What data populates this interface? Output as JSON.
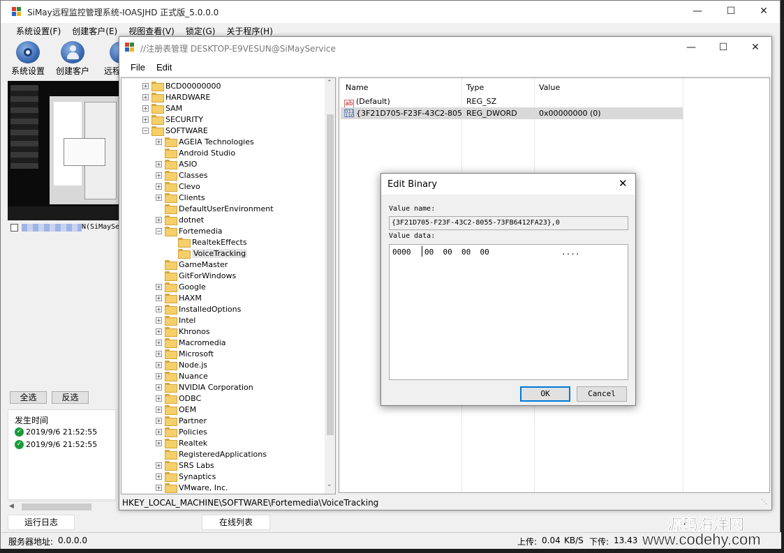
{
  "main_window": {
    "title": "SiMay远程监控管理系统-IOASJHD 正式版_5.0.0.0",
    "menu": [
      "系统设置(F)",
      "创建客户(E)",
      "视图查看(V)",
      "锁定(G)",
      "关于程序(H)"
    ],
    "toolbar": [
      "系统设置",
      "创建客户",
      "远程"
    ],
    "client_label": "N(SiMaySe",
    "select_all": "全选",
    "invert_select": "反选",
    "log_header": "发生时间",
    "log_entries": [
      "2019/9/6 21:52:55",
      "2019/9/6 21:52:55"
    ],
    "tabs": [
      "运行日志",
      "在线列表"
    ],
    "status": {
      "server_label": "服务器地址:",
      "server_value": "0.0.0.0",
      "upload_label": "上传:",
      "upload_value": "0.04",
      "upload_unit": "KB/S",
      "download_label": "下传:",
      "download_value": "13.43"
    }
  },
  "registry_window": {
    "title": "//注册表管理 DESKTOP-E9VESUN@SiMayService",
    "menu": [
      "File",
      "Edit"
    ],
    "tree": [
      {
        "label": "BCD00000000",
        "level": 0,
        "expander": "+"
      },
      {
        "label": "HARDWARE",
        "level": 0,
        "expander": "+"
      },
      {
        "label": "SAM",
        "level": 0,
        "expander": "+"
      },
      {
        "label": "SECURITY",
        "level": 0,
        "expander": "+"
      },
      {
        "label": "SOFTWARE",
        "level": 0,
        "expander": "-"
      },
      {
        "label": "AGEIA Technologies",
        "level": 1,
        "expander": "+"
      },
      {
        "label": "Android Studio",
        "level": 1,
        "expander": ""
      },
      {
        "label": "ASIO",
        "level": 1,
        "expander": "+"
      },
      {
        "label": "Classes",
        "level": 1,
        "expander": "+"
      },
      {
        "label": "Clevo",
        "level": 1,
        "expander": "+"
      },
      {
        "label": "Clients",
        "level": 1,
        "expander": "+"
      },
      {
        "label": "DefaultUserEnvironment",
        "level": 1,
        "expander": ""
      },
      {
        "label": "dotnet",
        "level": 1,
        "expander": "+"
      },
      {
        "label": "Fortemedia",
        "level": 1,
        "expander": "-"
      },
      {
        "label": "RealtekEffects",
        "level": 2,
        "expander": ""
      },
      {
        "label": "VoiceTracking",
        "level": 2,
        "expander": "",
        "selected": true
      },
      {
        "label": "GameMaster",
        "level": 1,
        "expander": ""
      },
      {
        "label": "GitForWindows",
        "level": 1,
        "expander": ""
      },
      {
        "label": "Google",
        "level": 1,
        "expander": "+"
      },
      {
        "label": "HAXM",
        "level": 1,
        "expander": "+"
      },
      {
        "label": "InstalledOptions",
        "level": 1,
        "expander": "+"
      },
      {
        "label": "Intel",
        "level": 1,
        "expander": "+"
      },
      {
        "label": "Khronos",
        "level": 1,
        "expander": "+"
      },
      {
        "label": "Macromedia",
        "level": 1,
        "expander": "+"
      },
      {
        "label": "Microsoft",
        "level": 1,
        "expander": "+"
      },
      {
        "label": "Node.js",
        "level": 1,
        "expander": "+"
      },
      {
        "label": "Nuance",
        "level": 1,
        "expander": "+"
      },
      {
        "label": "NVIDIA Corporation",
        "level": 1,
        "expander": "+"
      },
      {
        "label": "ODBC",
        "level": 1,
        "expander": "+"
      },
      {
        "label": "OEM",
        "level": 1,
        "expander": "+"
      },
      {
        "label": "Partner",
        "level": 1,
        "expander": "+"
      },
      {
        "label": "Policies",
        "level": 1,
        "expander": "+"
      },
      {
        "label": "Realtek",
        "level": 1,
        "expander": "+"
      },
      {
        "label": "RegisteredApplications",
        "level": 1,
        "expander": ""
      },
      {
        "label": "SRS Labs",
        "level": 1,
        "expander": "+"
      },
      {
        "label": "Synaptics",
        "level": 1,
        "expander": "+"
      },
      {
        "label": "VMware, Inc.",
        "level": 1,
        "expander": "+"
      }
    ],
    "columns": [
      "Name",
      "Type",
      "Value"
    ],
    "values": [
      {
        "icon": "ab",
        "name": "(Default)",
        "type": "REG_SZ",
        "value": ""
      },
      {
        "icon": "binary",
        "name": "{3F21D705-F23F-43C2-8055...",
        "type": "REG_DWORD",
        "value": "0x00000000 (0)"
      }
    ],
    "status_path": "HKEY_LOCAL_MACHINE\\SOFTWARE\\Fortemedia\\VoiceTracking"
  },
  "dialog": {
    "title": "Edit Binary",
    "value_name_label": "Value name:",
    "value_name": "{3F21D705-F23F-43C2-8055-73FB6412FA23},0",
    "value_data_label": "Value data:",
    "data_offset": "0000",
    "data_bytes": "00  00  00  00",
    "data_ascii": "....",
    "ok": "OK",
    "cancel": "Cancel"
  },
  "watermark": {
    "cn": "源码海洋网",
    "url": "www.codehy.com"
  }
}
